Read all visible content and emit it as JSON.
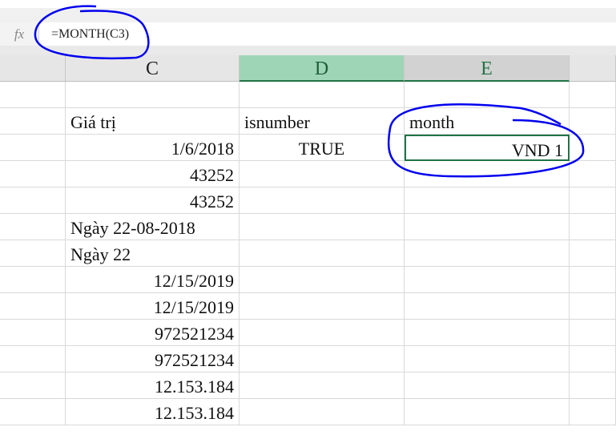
{
  "formula_bar": {
    "fx_label": "fx",
    "formula": "=MONTH(C3)"
  },
  "columns": [
    {
      "id": "C",
      "label": "C"
    },
    {
      "id": "D",
      "label": "D"
    },
    {
      "id": "E",
      "label": "E"
    }
  ],
  "rows": [
    {
      "C": "",
      "D": "",
      "E": ""
    },
    {
      "C": "Giá trị",
      "D": "isnumber",
      "E": "month"
    },
    {
      "C": "1/6/2018",
      "D": "TRUE",
      "E": "VND 1"
    },
    {
      "C": "43252",
      "D": "",
      "E": ""
    },
    {
      "C": "43252",
      "D": "",
      "E": ""
    },
    {
      "C": "Ngày 22-08-2018",
      "D": "",
      "E": ""
    },
    {
      "C": "Ngày 22",
      "D": "",
      "E": ""
    },
    {
      "C": "12/15/2019",
      "D": "",
      "E": ""
    },
    {
      "C": "12/15/2019",
      "D": "",
      "E": ""
    },
    {
      "C": "972521234",
      "D": "",
      "E": ""
    },
    {
      "C": "972521234",
      "D": "",
      "E": ""
    },
    {
      "C": "12.153.184",
      "D": "",
      "E": ""
    },
    {
      "C": "12.153.184",
      "D": "",
      "E": ""
    }
  ],
  "colors": {
    "accent": "#217346",
    "selected_header": "#9fd5b7",
    "annotation": "#0000ee"
  }
}
